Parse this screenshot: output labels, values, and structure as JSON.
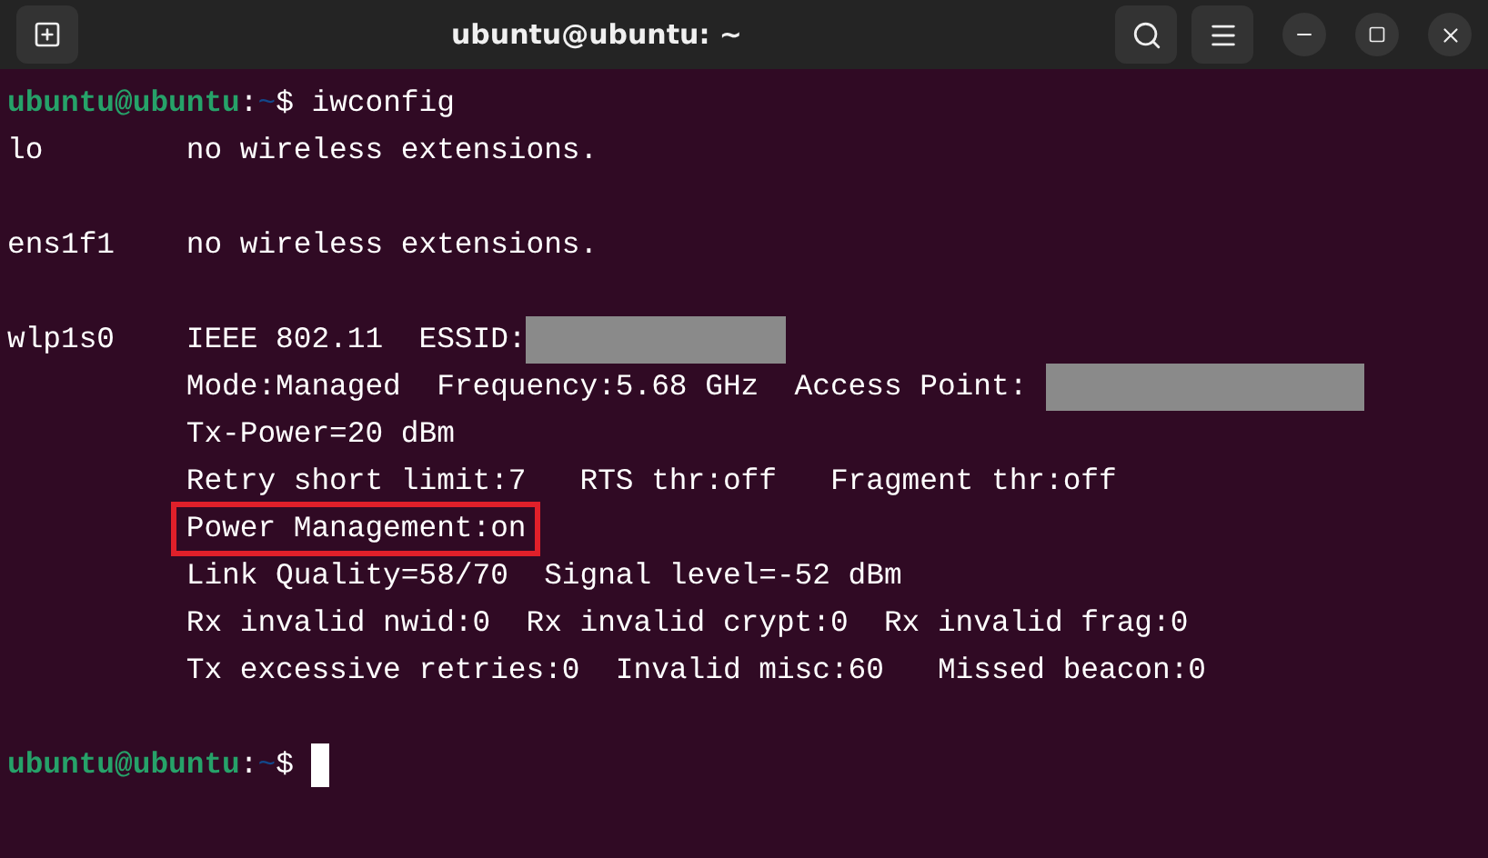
{
  "window": {
    "title": "ubuntu@ubuntu: ~"
  },
  "lines": [
    {
      "kind": "prompt",
      "parts": [
        {
          "kind": "user",
          "text": "ubuntu@ubuntu"
        },
        {
          "kind": "plain",
          "text": ":"
        },
        {
          "kind": "path",
          "text": "~"
        },
        {
          "kind": "plain",
          "text": "$ iwconfig"
        }
      ]
    },
    {
      "kind": "output",
      "segments": [
        {
          "kind": "text",
          "text": "lo        no wireless extensions."
        }
      ]
    },
    {
      "kind": "blank"
    },
    {
      "kind": "output",
      "segments": [
        {
          "kind": "text",
          "text": "ens1f1    no wireless extensions."
        }
      ]
    },
    {
      "kind": "blank"
    },
    {
      "kind": "output",
      "segments": [
        {
          "kind": "text",
          "text": "wlp1s0    IEEE 802.11  ESSID:"
        },
        {
          "kind": "redacted"
        }
      ]
    },
    {
      "kind": "output",
      "indented": true,
      "segments": [
        {
          "kind": "text",
          "text": "Mode:Managed  Frequency:5.68 GHz  Access Point: "
        },
        {
          "kind": "redacted"
        }
      ]
    },
    {
      "kind": "output",
      "indented": true,
      "segments": [
        {
          "kind": "text",
          "text": "Tx-Power=20 dBm"
        }
      ]
    },
    {
      "kind": "output",
      "indented": true,
      "segments": [
        {
          "kind": "text",
          "text": "Retry short limit:7   RTS thr:off   Fragment thr:off"
        }
      ]
    },
    {
      "kind": "output",
      "indented": true,
      "segments": [
        {
          "kind": "highlight",
          "text": "Power Management:on"
        }
      ]
    },
    {
      "kind": "output",
      "indented": true,
      "segments": [
        {
          "kind": "text",
          "text": "Link Quality=58/70  Signal level=-52 dBm"
        }
      ]
    },
    {
      "kind": "output",
      "indented": true,
      "segments": [
        {
          "kind": "text",
          "text": "Rx invalid nwid:0  Rx invalid crypt:0  Rx invalid frag:0"
        }
      ]
    },
    {
      "kind": "output",
      "indented": true,
      "segments": [
        {
          "kind": "text",
          "text": "Tx excessive retries:0  Invalid misc:60   Missed beacon:0"
        }
      ]
    },
    {
      "kind": "blank"
    },
    {
      "kind": "prompt",
      "cursor": true,
      "parts": [
        {
          "kind": "user",
          "text": "ubuntu@ubuntu"
        },
        {
          "kind": "plain",
          "text": ":"
        },
        {
          "kind": "path",
          "text": "~"
        },
        {
          "kind": "plain",
          "text": "$ "
        }
      ]
    }
  ]
}
